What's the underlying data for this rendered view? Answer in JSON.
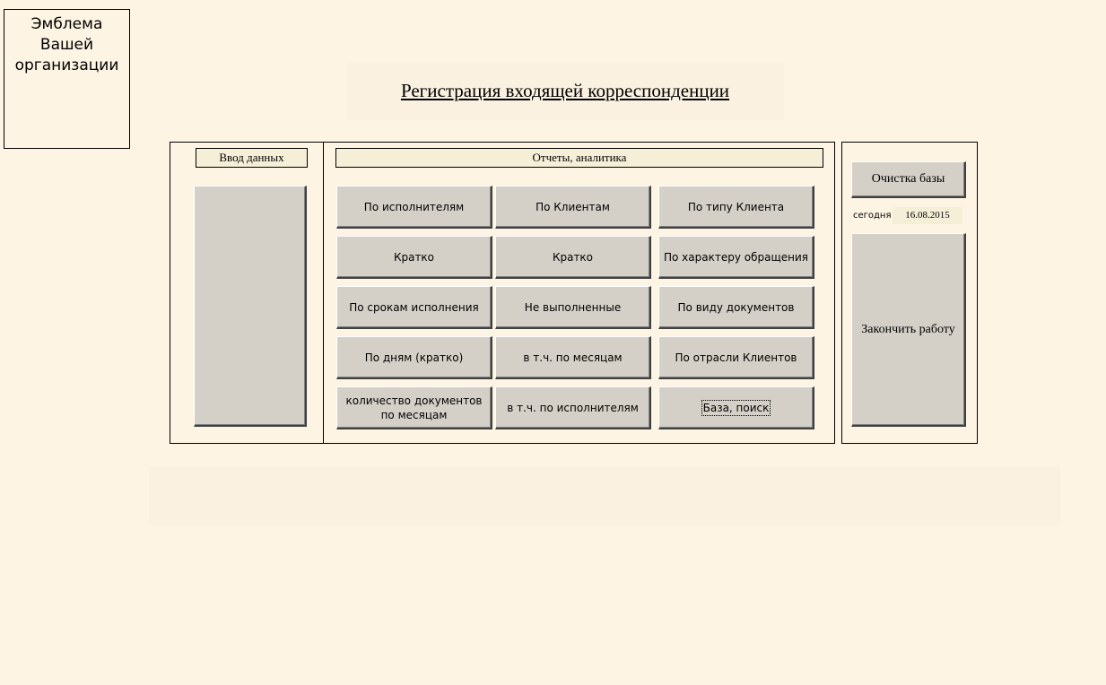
{
  "logo": {
    "text": "Эмблема Вашей организации"
  },
  "title": "Регистрация входящей корреспонденции",
  "data_entry": {
    "label": "Ввод данных"
  },
  "reports": {
    "label": "Отчеты, аналитика",
    "buttons": [
      [
        "По исполнителям",
        "По Клиентам",
        "По типу Клиента"
      ],
      [
        "Кратко",
        "Кратко",
        "По характеру обращения"
      ],
      [
        "По срокам исполнения",
        "Не выполненные",
        "По виду документов"
      ],
      [
        "По дням (кратко)",
        "в т.ч. по месяцам",
        "По отрасли Клиентов"
      ],
      [
        "количество документов по месяцам",
        "в т.ч. по исполнителям",
        "База, поиск"
      ]
    ]
  },
  "side": {
    "clear_db": "Очистка базы",
    "today_label": "сегодня",
    "today_value": "16.08.2015",
    "finish": "Закончить работу"
  }
}
